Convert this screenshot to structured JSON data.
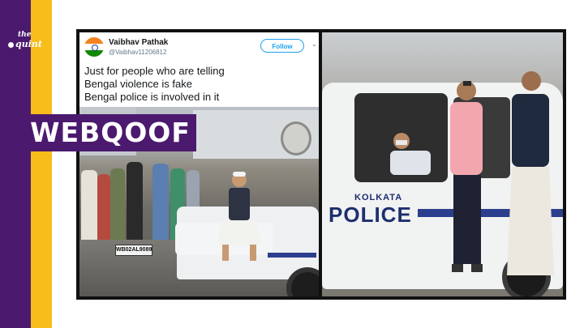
{
  "brand": {
    "logo_line1": "the",
    "logo_line2": "quint",
    "accent_purple": "#4b1a6e",
    "accent_yellow": "#f7bd1a"
  },
  "banner": {
    "label": "WEBQOOF"
  },
  "tweet": {
    "name": "Vaibhav Pathak",
    "handle": "@Vaibhav11206812",
    "follow_label": "Follow",
    "chevron": "⌄",
    "lines": [
      "Just for people who are telling",
      "Bengal violence is fake",
      "Bengal police is involved in it"
    ]
  },
  "photo_left": {
    "plate_text": "WB02AL9089"
  },
  "photo_right": {
    "vehicle_line1": "KOLKATA",
    "vehicle_line2": "POLICE"
  }
}
